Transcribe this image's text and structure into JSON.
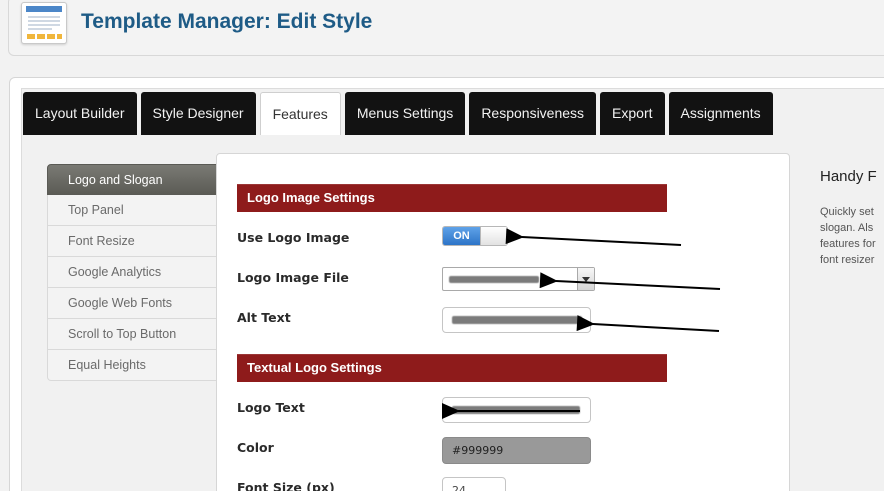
{
  "header": {
    "title": "Template Manager: Edit Style",
    "icon": "template-icon"
  },
  "tabs": [
    {
      "label": "Layout Builder",
      "active": false
    },
    {
      "label": "Style Designer",
      "active": false
    },
    {
      "label": "Features",
      "active": true
    },
    {
      "label": "Menus Settings",
      "active": false
    },
    {
      "label": "Responsiveness",
      "active": false
    },
    {
      "label": "Export",
      "active": false
    },
    {
      "label": "Assignments",
      "active": false
    }
  ],
  "sidebar": {
    "items": [
      {
        "label": "Logo and Slogan",
        "active": true
      },
      {
        "label": "Top Panel"
      },
      {
        "label": "Font Resize"
      },
      {
        "label": "Google Analytics"
      },
      {
        "label": "Google Web Fonts"
      },
      {
        "label": "Scroll to Top Button"
      },
      {
        "label": "Equal Heights"
      }
    ]
  },
  "sections": {
    "logo_image": "Logo Image Settings",
    "textual_logo": "Textual Logo Settings"
  },
  "fields": {
    "use_logo_image": {
      "label": "Use Logo Image",
      "toggle_state": "ON"
    },
    "logo_image_file": {
      "label": "Logo Image File",
      "value": ""
    },
    "alt_text": {
      "label": "Alt Text",
      "value": ""
    },
    "logo_text": {
      "label": "Logo Text",
      "value": ""
    },
    "color": {
      "label": "Color",
      "value": "#999999"
    },
    "font_size": {
      "label": "Font Size (px)",
      "value": "24"
    }
  },
  "help": {
    "title": "Handy F",
    "text": "Quickly set\nslogan. Als\nfeatures for\nfont resizer"
  },
  "colors": {
    "title": "#1e5b86",
    "section_bar": "#8e1b1b",
    "toggle_on": "#2d74c7",
    "tab_dark": "#121212",
    "color_swatch": "#999999"
  }
}
